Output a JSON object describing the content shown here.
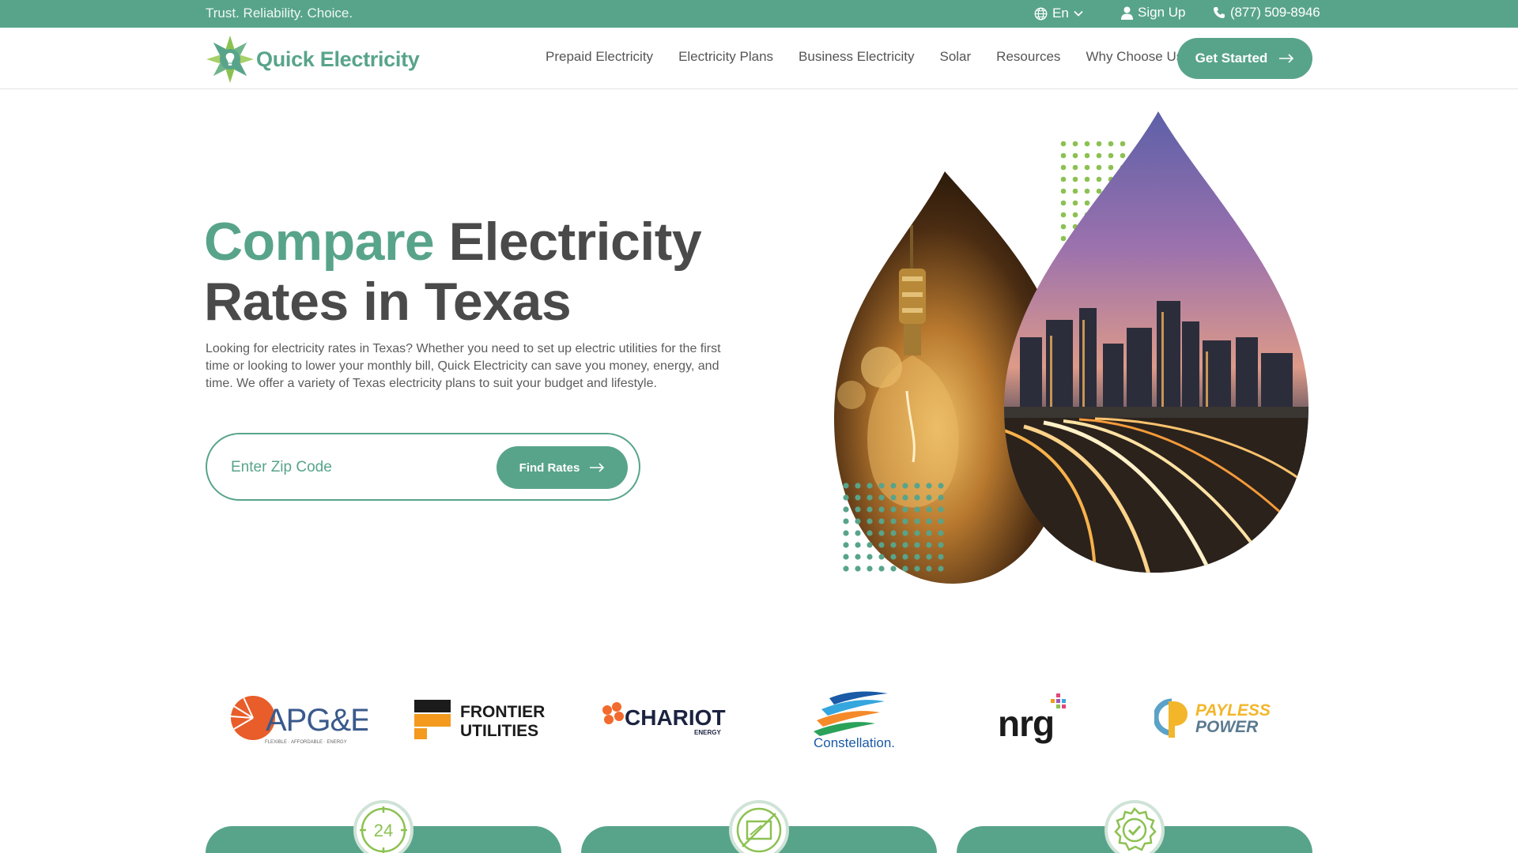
{
  "topbar": {
    "tagline": "Trust. Reliability. Choice.",
    "language": "En",
    "signup": "Sign Up",
    "phone": "(877) 509-8946"
  },
  "header": {
    "logo_text": "Quick Electricity",
    "nav": [
      "Prepaid Electricity",
      "Electricity Plans",
      "Business Electricity",
      "Solar",
      "Resources",
      "Why Choose Us"
    ],
    "cta": "Get Started"
  },
  "hero": {
    "title_accent": "Compare",
    "title_rest": "Electricity",
    "title_line2": "Rates in Texas",
    "description": "Looking for electricity rates in Texas? Whether you need to set up electric utilities for the first time or looking to lower your monthly bill, Quick Electricity can save you money, energy, and time. We offer a variety of Texas electricity plans to suit your budget and lifestyle.",
    "zip_placeholder": "Enter Zip Code",
    "zip_value": "",
    "find_button": "Find Rates"
  },
  "providers": {
    "apge": {
      "name": "APG&E",
      "tagline": "FLEXIBLE · AFFORDABLE · ENERGY"
    },
    "frontier": {
      "line1": "FRONTIER",
      "line2": "UTILITIES"
    },
    "chariot": {
      "name": "CHARIOT",
      "sub": "ENERGY"
    },
    "constellation": {
      "name": "Constellation."
    },
    "nrg": {
      "name": "nrg"
    },
    "payless": {
      "line1": "PAYLESS",
      "line2": "POWER"
    }
  },
  "features": {
    "badge_24": "24"
  },
  "colors": {
    "brand_green": "#58a48a",
    "text_dark": "#4a4a4a",
    "icon_lime": "#8cc152"
  }
}
